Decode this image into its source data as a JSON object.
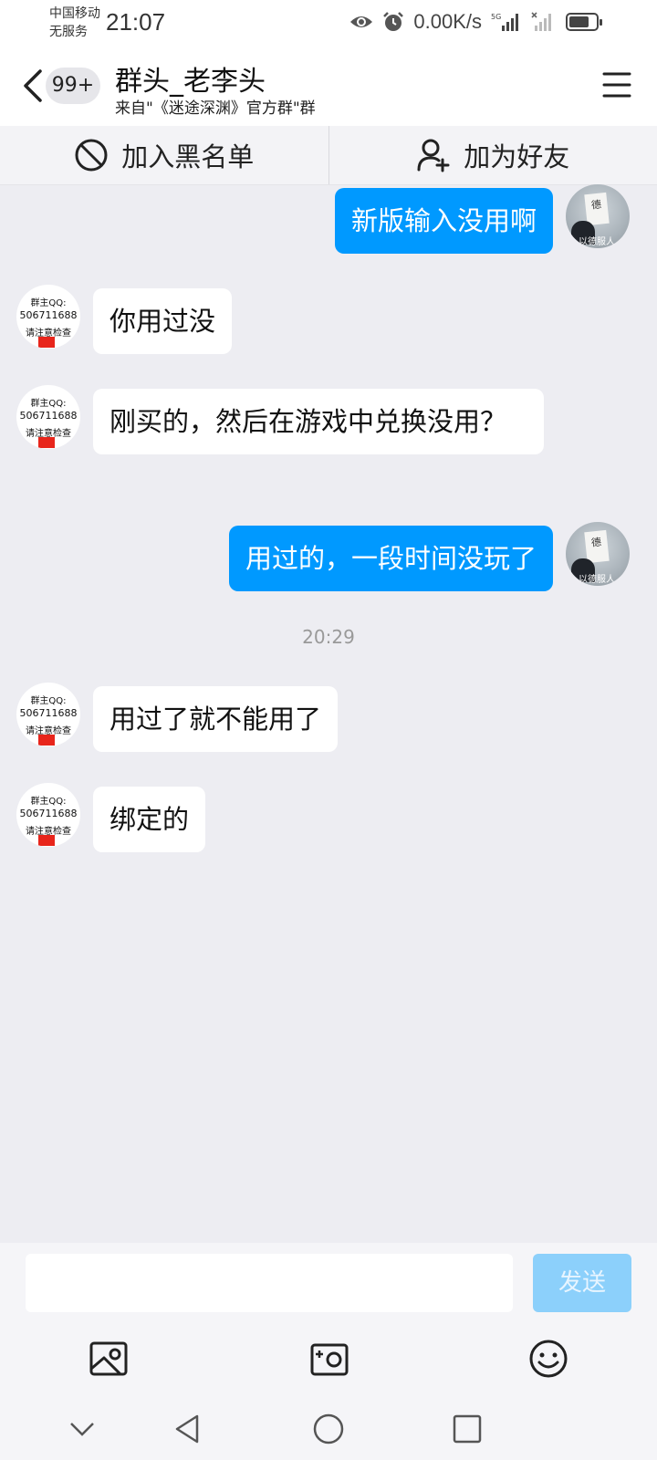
{
  "status_bar": {
    "carrier_line1": "中国移动",
    "carrier_line2": "无服务",
    "time": "21:07",
    "net_speed": "0.00K/s",
    "network_label": "5G",
    "battery_level": 0.75,
    "icons": [
      "eye-icon",
      "alarm-icon",
      "signal-icon",
      "no-signal-icon",
      "battery-icon"
    ]
  },
  "header": {
    "unread_badge": "99+",
    "title": "群头_老李头",
    "subtitle": "来自\"《迷途深渊》官方群\"群"
  },
  "actions": {
    "block_label": "加入黑名单",
    "add_friend_label": "加为好友"
  },
  "avatars": {
    "left_line1": "群主QQ:",
    "left_line2": "506711688",
    "left_line3": "请注意检查",
    "right_paper": "德",
    "right_caption": "以德服人"
  },
  "messages": [
    {
      "side": "right",
      "text": "新版输入没用啊"
    },
    {
      "side": "left",
      "text": "你用过没"
    },
    {
      "side": "left",
      "text": "刚买的，然后在游戏中兑换没用？"
    },
    {
      "side": "right",
      "text": "用过的，一段时间没玩了"
    },
    {
      "side": "left",
      "text": "用过了就不能用了"
    },
    {
      "side": "left",
      "text": "绑定的"
    }
  ],
  "timestamp": "20:29",
  "input": {
    "value": "",
    "send_label": "发送"
  },
  "colors": {
    "accent": "#0099ff",
    "send_disabled": "#8cd0fb",
    "background": "#ededf2"
  }
}
